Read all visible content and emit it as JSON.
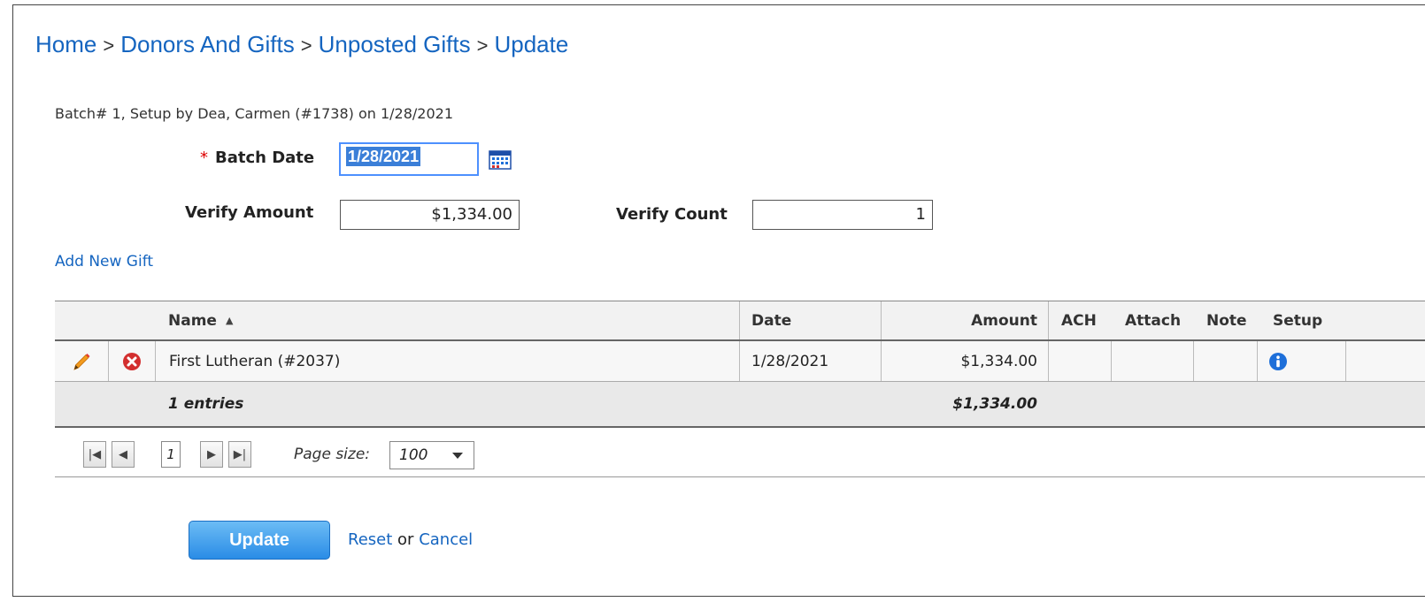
{
  "breadcrumb": {
    "home": "Home",
    "donors": "Donors And Gifts",
    "unposted": "Unposted Gifts",
    "current": "Update",
    "separator": ">"
  },
  "batch_info": "Batch# 1, Setup by Dea, Carmen (#1738) on 1/28/2021",
  "form": {
    "required_mark": "*",
    "batch_date_label": "Batch Date",
    "batch_date_value": "1/28/2021",
    "verify_amount_label": "Verify Amount",
    "verify_amount_value": "$1,334.00",
    "verify_count_label": "Verify Count",
    "verify_count_value": "1"
  },
  "add_new_gift": "Add New Gift",
  "grid": {
    "columns": {
      "name": "Name",
      "date": "Date",
      "amount": "Amount",
      "ach": "ACH",
      "attach": "Attach",
      "note": "Note",
      "setup": "Setup"
    },
    "sort_indicator": "▲",
    "rows": [
      {
        "name": "First Lutheran (#2037)",
        "date": "1/28/2021",
        "amount": "$1,334.00"
      }
    ],
    "footer": {
      "entries": "1 entries",
      "total": "$1,334.00"
    },
    "pager": {
      "page": "1",
      "page_size_label": "Page size:",
      "page_size_value": "100"
    }
  },
  "buttons": {
    "update": "Update",
    "reset": "Reset",
    "or": "or",
    "cancel": "Cancel"
  },
  "icons": {
    "edit": "pencil-icon",
    "delete": "delete-x-icon",
    "info": "info-icon",
    "calendar": "calendar-icon"
  },
  "colors": {
    "link": "#1565c0",
    "required": "#dd0000",
    "button_top": "#6cbcf5",
    "button_bottom": "#2a8ce6",
    "delete": "#d32f2f",
    "info": "#1e6fd9",
    "pencil": "#f29b1e"
  }
}
